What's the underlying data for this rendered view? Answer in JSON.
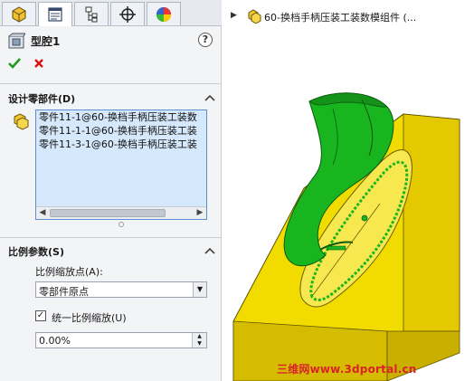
{
  "tabs": [
    {
      "name": "feature-manager-tab",
      "icon": "cube-icon"
    },
    {
      "name": "property-manager-tab",
      "icon": "property-sheet-icon",
      "active": true
    },
    {
      "name": "configuration-manager-tab",
      "icon": "configuration-icon"
    },
    {
      "name": "dimxpert-tab",
      "icon": "crosshair-icon"
    },
    {
      "name": "display-manager-tab",
      "icon": "color-wheel-icon"
    }
  ],
  "feature": {
    "title": "型腔1",
    "help": "?"
  },
  "design_components": {
    "title": "设计零部件(D)",
    "items": [
      "零件11-1@60-换档手柄压装工装数",
      "零件11-1-1@60-换档手柄压装工装",
      "零件11-3-1@60-换档手柄压装工装"
    ]
  },
  "scale_params": {
    "title": "比例参数(S)",
    "point_label": "比例缩放点(A):",
    "point_value": "零部件原点",
    "uniform_label": "统一比例缩放(U)",
    "uniform_checked": "✓",
    "scale_value": "0.00%"
  },
  "tree": {
    "label": "60-换档手柄压装工装数模组件 (..."
  },
  "watermark": "三维网www.3dportal.cn",
  "colors": {
    "mold_yellow": "#f2dc00",
    "part_green": "#19b51f",
    "watermark_red": "#d9232c",
    "list_bg": "#d6e8fb"
  }
}
